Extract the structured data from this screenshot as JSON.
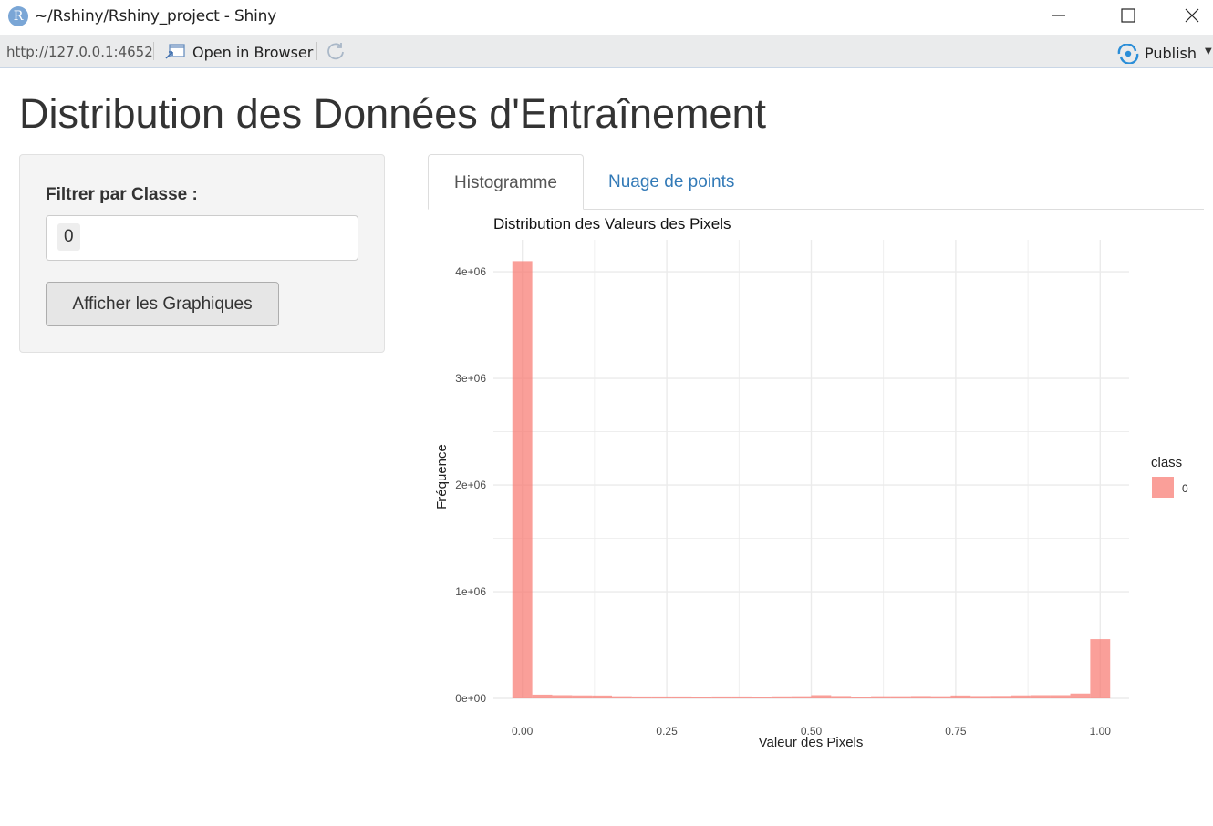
{
  "window": {
    "title": "~/Rshiny/Rshiny_project - Shiny",
    "logo_letter": "R"
  },
  "toolbar": {
    "url": "http://127.0.0.1:4652",
    "open_in_browser": "Open in Browser",
    "publish": "Publish"
  },
  "page": {
    "title": "Distribution des Données d'Entraînement"
  },
  "sidebar": {
    "filter_label": "Filtrer par Classe :",
    "filter_value": "0",
    "button_label": "Afficher les Graphiques"
  },
  "tabs": [
    {
      "label": "Histogramme",
      "active": true
    },
    {
      "label": "Nuage de points",
      "active": false
    }
  ],
  "colors": {
    "bar": "#f8766d",
    "link": "#337ab7",
    "grid": "#ebebeb"
  },
  "chart_data": {
    "type": "bar",
    "title": "Distribution des Valeurs des Pixels",
    "xlabel": "Valeur des Pixels",
    "ylabel": "Fréquence",
    "xlim": [
      -0.05,
      1.05
    ],
    "ylim": [
      0,
      4300000
    ],
    "x_ticks": [
      0,
      0.25,
      0.5,
      0.75,
      1
    ],
    "x_tick_labels": [
      "0.00",
      "0.25",
      "0.50",
      "0.75",
      "1.00"
    ],
    "y_ticks": [
      0,
      1000000,
      2000000,
      3000000,
      4000000
    ],
    "y_tick_labels": [
      "0e+00",
      "1e+06",
      "2e+06",
      "3e+06",
      "4e+06"
    ],
    "bin_width": 0.0345,
    "x": [
      0,
      0.0345,
      0.069,
      0.1034,
      0.1379,
      0.1724,
      0.2069,
      0.2414,
      0.2759,
      0.3103,
      0.3448,
      0.3793,
      0.4138,
      0.4483,
      0.4828,
      0.5172,
      0.5517,
      0.5862,
      0.6207,
      0.6552,
      0.6897,
      0.7241,
      0.7586,
      0.7931,
      0.8276,
      0.8621,
      0.8966,
      0.931,
      0.9655,
      1.0
    ],
    "series": [
      {
        "name": "0",
        "values": [
          4100000,
          35000,
          30000,
          28000,
          27000,
          20000,
          18000,
          18000,
          18000,
          17000,
          18000,
          18000,
          12000,
          19000,
          20000,
          30000,
          22000,
          14000,
          20000,
          20000,
          22000,
          20000,
          27000,
          22000,
          23000,
          28000,
          30000,
          30000,
          45000,
          555000
        ]
      }
    ],
    "legend": {
      "title": "class",
      "entries": [
        "0"
      ],
      "position": "right"
    },
    "grid": true
  }
}
